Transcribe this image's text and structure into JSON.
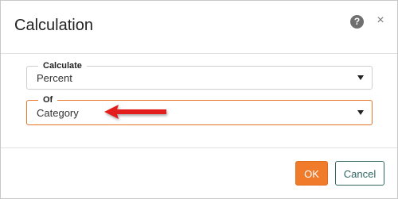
{
  "dialog": {
    "title": "Calculation",
    "help_icon": "question-circle-icon",
    "help_glyph": "?",
    "close_icon": "close-icon",
    "close_glyph": "×"
  },
  "fields": {
    "calculate": {
      "label": "Calculate",
      "value": "Percent",
      "icon": "chevron-down-icon"
    },
    "of": {
      "label": "Of",
      "value": "Category",
      "icon": "chevron-down-icon",
      "focus_color": "#e8752a"
    }
  },
  "annotation": {
    "icon": "red-arrow-icon",
    "color": "#e31c1c"
  },
  "buttons": {
    "ok_label": "OK",
    "cancel_label": "Cancel",
    "ok_color": "#ef7b2b",
    "cancel_color": "#2f6662"
  }
}
